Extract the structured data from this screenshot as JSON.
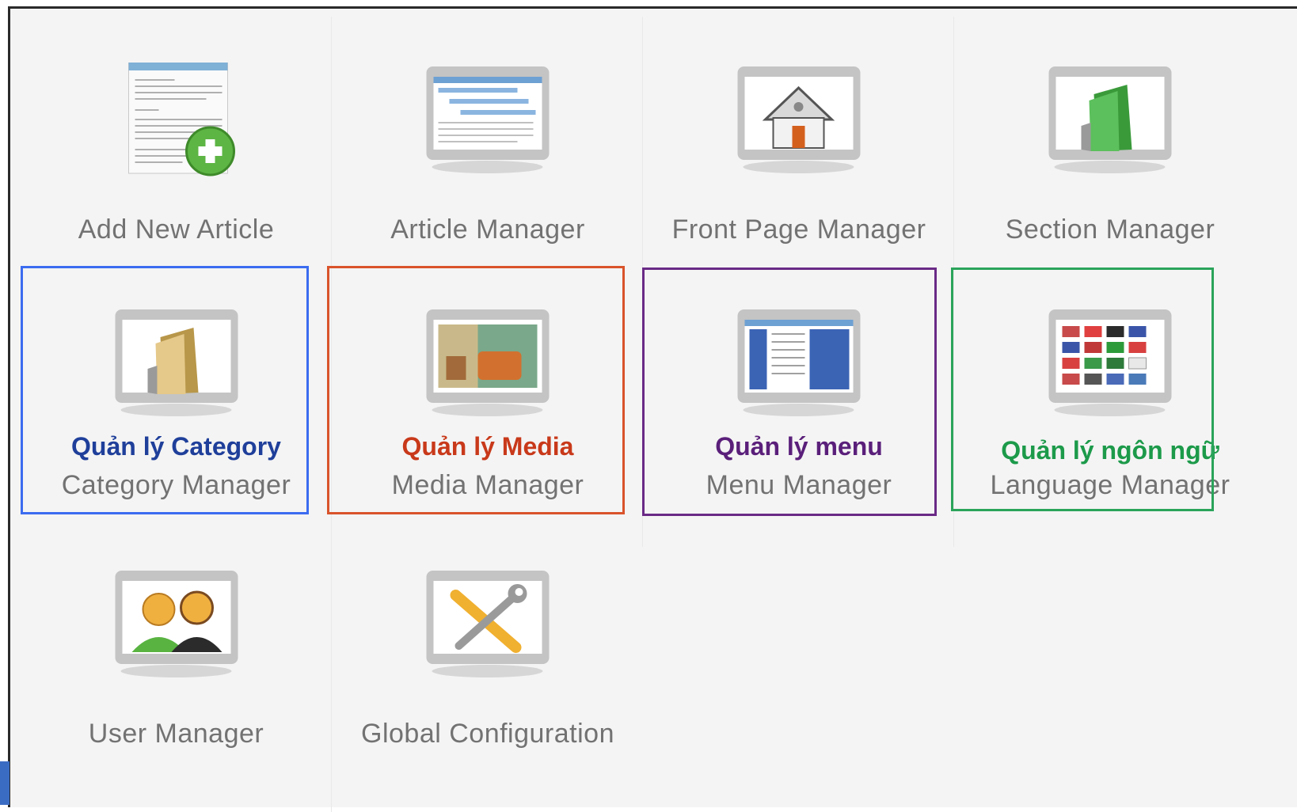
{
  "items": [
    {
      "label": "Add New Article",
      "icon": "add-article-icon"
    },
    {
      "label": "Article Manager",
      "icon": "article-manager-icon"
    },
    {
      "label": "Front Page Manager",
      "icon": "home-icon"
    },
    {
      "label": "Section Manager",
      "icon": "section-folder-icon"
    },
    {
      "vn_label": "Quản lý Category",
      "label": "Category Manager",
      "icon": "category-folder-icon",
      "color": "#1f3f9a",
      "box": "#3b6cf0"
    },
    {
      "vn_label": "Quản lý Media",
      "label": "Media Manager",
      "icon": "media-icon",
      "color": "#c8391a",
      "box": "#d9532b"
    },
    {
      "vn_label": "Quản lý menu",
      "label": "Menu Manager",
      "icon": "menu-icon",
      "color": "#5a1f7a",
      "box": "#6a2a86"
    },
    {
      "vn_label": "Quản lý ngôn ngữ",
      "label": "Language Manager",
      "icon": "language-flags-icon",
      "color": "#1c9a4a",
      "box": "#2aa45a"
    },
    {
      "label": "User Manager",
      "icon": "users-icon"
    },
    {
      "label": "Global Configuration",
      "icon": "tools-icon"
    }
  ]
}
